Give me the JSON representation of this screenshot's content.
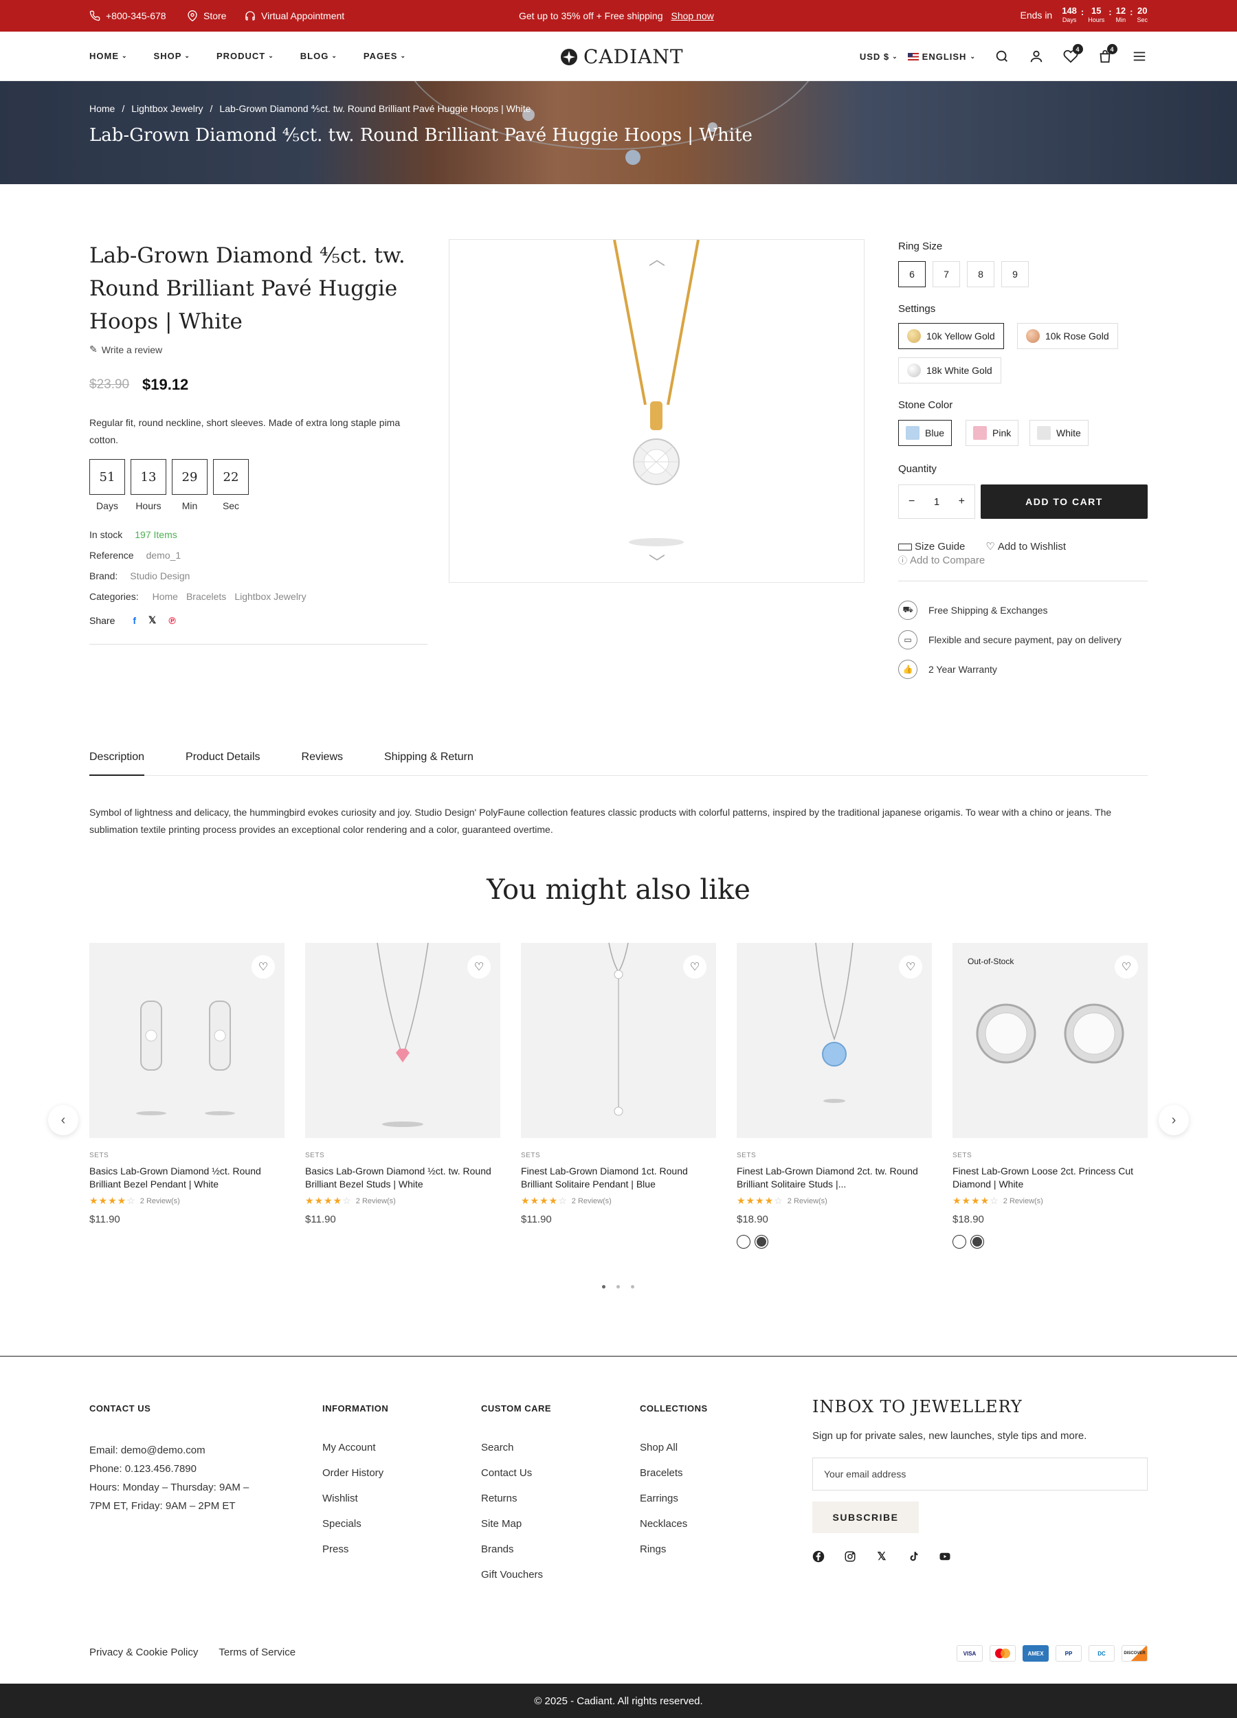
{
  "topbar": {
    "phone": "+800-345-678",
    "store": "Store",
    "appointment": "Virtual Appointment",
    "promo": "Get up to 35% off + Free shipping",
    "shop_now": "Shop now",
    "ends_in": "Ends in",
    "countdown": [
      {
        "value": "148",
        "label": "Days"
      },
      {
        "value": "15",
        "label": "Hours"
      },
      {
        "value": "12",
        "label": "Min"
      },
      {
        "value": "20",
        "label": "Sec"
      }
    ]
  },
  "header": {
    "nav": [
      "HOME",
      "SHOP",
      "PRODUCT",
      "BLOG",
      "PAGES"
    ],
    "logo": "CADIANT",
    "currency": "USD $",
    "language": "ENGLISH",
    "wishlist_count": "4",
    "cart_count": "4"
  },
  "hero": {
    "breadcrumb": [
      "Home",
      "Lightbox Jewelry",
      "Lab-Grown Diamond ⅘ct. tw. Round Brilliant Pavé Huggie Hoops | White"
    ],
    "title": "Lab-Grown Diamond ⅘ct. tw. Round Brilliant Pavé Huggie Hoops | White"
  },
  "product": {
    "title": "Lab-Grown Diamond ⅘ct. tw. Round Brilliant Pavé Huggie Hoops | White",
    "write_review": "Write a review",
    "old_price": "$23.90",
    "price": "$19.12",
    "description": "Regular fit, round neckline, short sleeves. Made of extra long staple pima cotton.",
    "countdown": [
      {
        "value": "51",
        "label": "Days"
      },
      {
        "value": "13",
        "label": "Hours"
      },
      {
        "value": "29",
        "label": "Min"
      },
      {
        "value": "22",
        "label": "Sec"
      }
    ],
    "stock_label": "In stock",
    "stock_value": "197 Items",
    "reference_label": "Reference",
    "reference_value": "demo_1",
    "brand_label": "Brand:",
    "brand_value": "Studio Design",
    "categories_label": "Categories:",
    "categories": [
      "Home",
      "Bracelets",
      "Lightbox Jewelry"
    ],
    "share_label": "Share"
  },
  "options": {
    "ring_size_label": "Ring Size",
    "ring_sizes": [
      "6",
      "7",
      "8",
      "9"
    ],
    "settings_label": "Settings",
    "settings": [
      "10k Yellow Gold",
      "10k Rose Gold",
      "18k White Gold"
    ],
    "stone_label": "Stone Color",
    "stones": [
      "Blue",
      "Pink",
      "White"
    ],
    "quantity_label": "Quantity",
    "quantity": "1",
    "add_to_cart": "ADD TO CART",
    "size_guide": "Size Guide",
    "add_wishlist": "Add to Wishlist",
    "add_compare": "Add to Compare",
    "features": [
      "Free Shipping & Exchanges",
      "Flexible and secure payment, pay on delivery",
      "2 Year Warranty"
    ]
  },
  "tabs": [
    "Description",
    "Product Details",
    "Reviews",
    "Shipping & Return"
  ],
  "description_text": "Symbol of lightness and delicacy, the hummingbird evokes curiosity and joy. Studio Design' PolyFaune collection features classic products with colorful patterns, inspired by the traditional japanese origamis. To wear with a chino or jeans. The sublimation textile printing process provides an exceptional color rendering and a color, guaranteed overtime.",
  "related_title": "You might also like",
  "related": [
    {
      "category": "SETS",
      "name": "Basics Lab-Grown Diamond ½ct. Round Brilliant Bezel Pendant | White",
      "reviews": "2 Review(s)",
      "price": "$11.90",
      "rating": 4
    },
    {
      "category": "SETS",
      "name": "Basics Lab-Grown Diamond ½ct. tw. Round Brilliant Bezel Studs | White",
      "reviews": "2 Review(s)",
      "price": "$11.90",
      "rating": 4
    },
    {
      "category": "SETS",
      "name": "Finest Lab-Grown Diamond 1ct. Round Brilliant Solitaire Pendant | Blue",
      "reviews": "2 Review(s)",
      "price": "$11.90",
      "rating": 4
    },
    {
      "category": "SETS",
      "name": "Finest Lab-Grown Diamond 2ct. tw. Round Brilliant Solitaire Studs |...",
      "reviews": "2 Review(s)",
      "price": "$18.90",
      "rating": 4
    },
    {
      "category": "SETS",
      "name": "Finest Lab-Grown Loose 2ct. Princess Cut Diamond | White",
      "reviews": "2 Review(s)",
      "price": "$18.90",
      "rating": 4,
      "badge": "Out-of-Stock"
    }
  ],
  "footer": {
    "contact_head": "CONTACT US",
    "contact_lines": [
      "Email: demo@demo.com",
      "Phone: 0.123.456.7890",
      "Hours: Monday – Thursday: 9AM – 7PM ET, Friday: 9AM – 2PM ET"
    ],
    "info_head": "INFORMATION",
    "info_links": [
      "My Account",
      "Order History",
      "Wishlist",
      "Specials",
      "Press"
    ],
    "care_head": "CUSTOM CARE",
    "care_links": [
      "Search",
      "Contact Us",
      "Returns",
      "Site Map",
      "Brands",
      "Gift Vouchers"
    ],
    "collections_head": "COLLECTIONS",
    "collections_links": [
      "Shop All",
      "Bracelets",
      "Earrings",
      "Necklaces",
      "Rings"
    ],
    "inbox_title": "INBOX TO JEWELLERY",
    "inbox_sub": "Sign up for private sales, new launches, style tips and more.",
    "email_placeholder": "Your email address",
    "subscribe": "SUBSCRIBE",
    "privacy": "Privacy & Cookie Policy",
    "terms": "Terms of Service",
    "payments": [
      "VISA",
      "MC",
      "AMEX",
      "PP",
      "DC",
      "DISCOVER"
    ],
    "copyright": "© 2025 - Cadiant. All rights reserved."
  },
  "colors": {
    "topbar": "#b71c1c",
    "dark": "#222222",
    "star": "#f5a623",
    "stock": "#4caf50"
  }
}
